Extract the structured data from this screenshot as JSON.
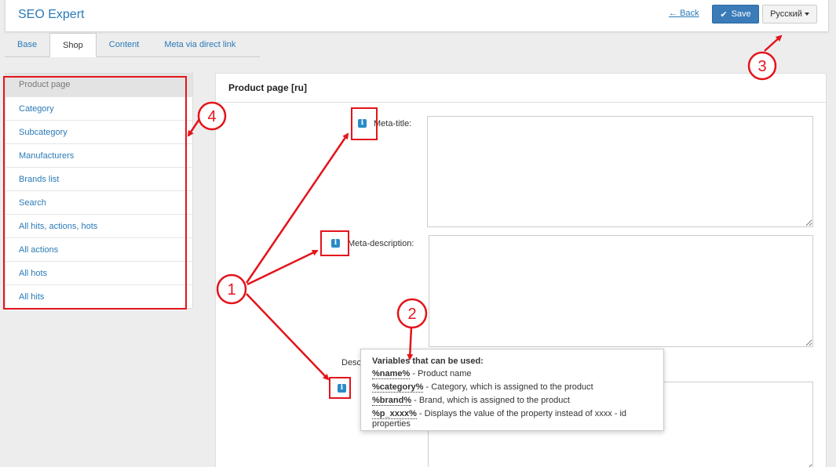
{
  "header": {
    "app_title": "SEO Expert",
    "back_label": "Back",
    "back_arrow": "←",
    "save_label": "Save",
    "language": "Русский"
  },
  "tabs": [
    {
      "label": "Base",
      "active": false
    },
    {
      "label": "Shop",
      "active": true
    },
    {
      "label": "Content",
      "active": false
    },
    {
      "label": "Meta via direct link",
      "active": false
    }
  ],
  "sidebar": {
    "items": [
      {
        "label": "Product page",
        "active": true
      },
      {
        "label": "Category"
      },
      {
        "label": "Subcategory"
      },
      {
        "label": "Manufacturers"
      },
      {
        "label": "Brands list"
      },
      {
        "label": "Search"
      },
      {
        "label": "All hits, actions, hots"
      },
      {
        "label": "All actions"
      },
      {
        "label": "All hots"
      },
      {
        "label": "All hits"
      }
    ]
  },
  "panel": {
    "title": "Product page [ru]",
    "fields": {
      "meta_title": {
        "label": "Meta-title:",
        "value": ""
      },
      "meta_description": {
        "label": "Meta-description:",
        "value": ""
      },
      "description": {
        "label": "Desc",
        "value": ""
      }
    }
  },
  "tooltip": {
    "title": "Variables that can be used:",
    "rows": [
      {
        "var": "%name%",
        "desc": " - Product name"
      },
      {
        "var": "%category%",
        "desc": " - Category, which is assigned to the product"
      },
      {
        "var": "%brand%",
        "desc": " - Brand, which is assigned to the product"
      },
      {
        "var": "%p_xxxx%",
        "desc": " - Displays the value of the property instead of xxxx - id properties"
      }
    ]
  },
  "annotations": {
    "labels": [
      "1",
      "2",
      "3",
      "4"
    ],
    "color": "#e3141b"
  },
  "colors": {
    "accent": "#2a7ab8",
    "save_button": "#3a7bb8",
    "info_icon": "#2a8bc7"
  },
  "icons": {
    "info": "i",
    "check": "✔"
  }
}
